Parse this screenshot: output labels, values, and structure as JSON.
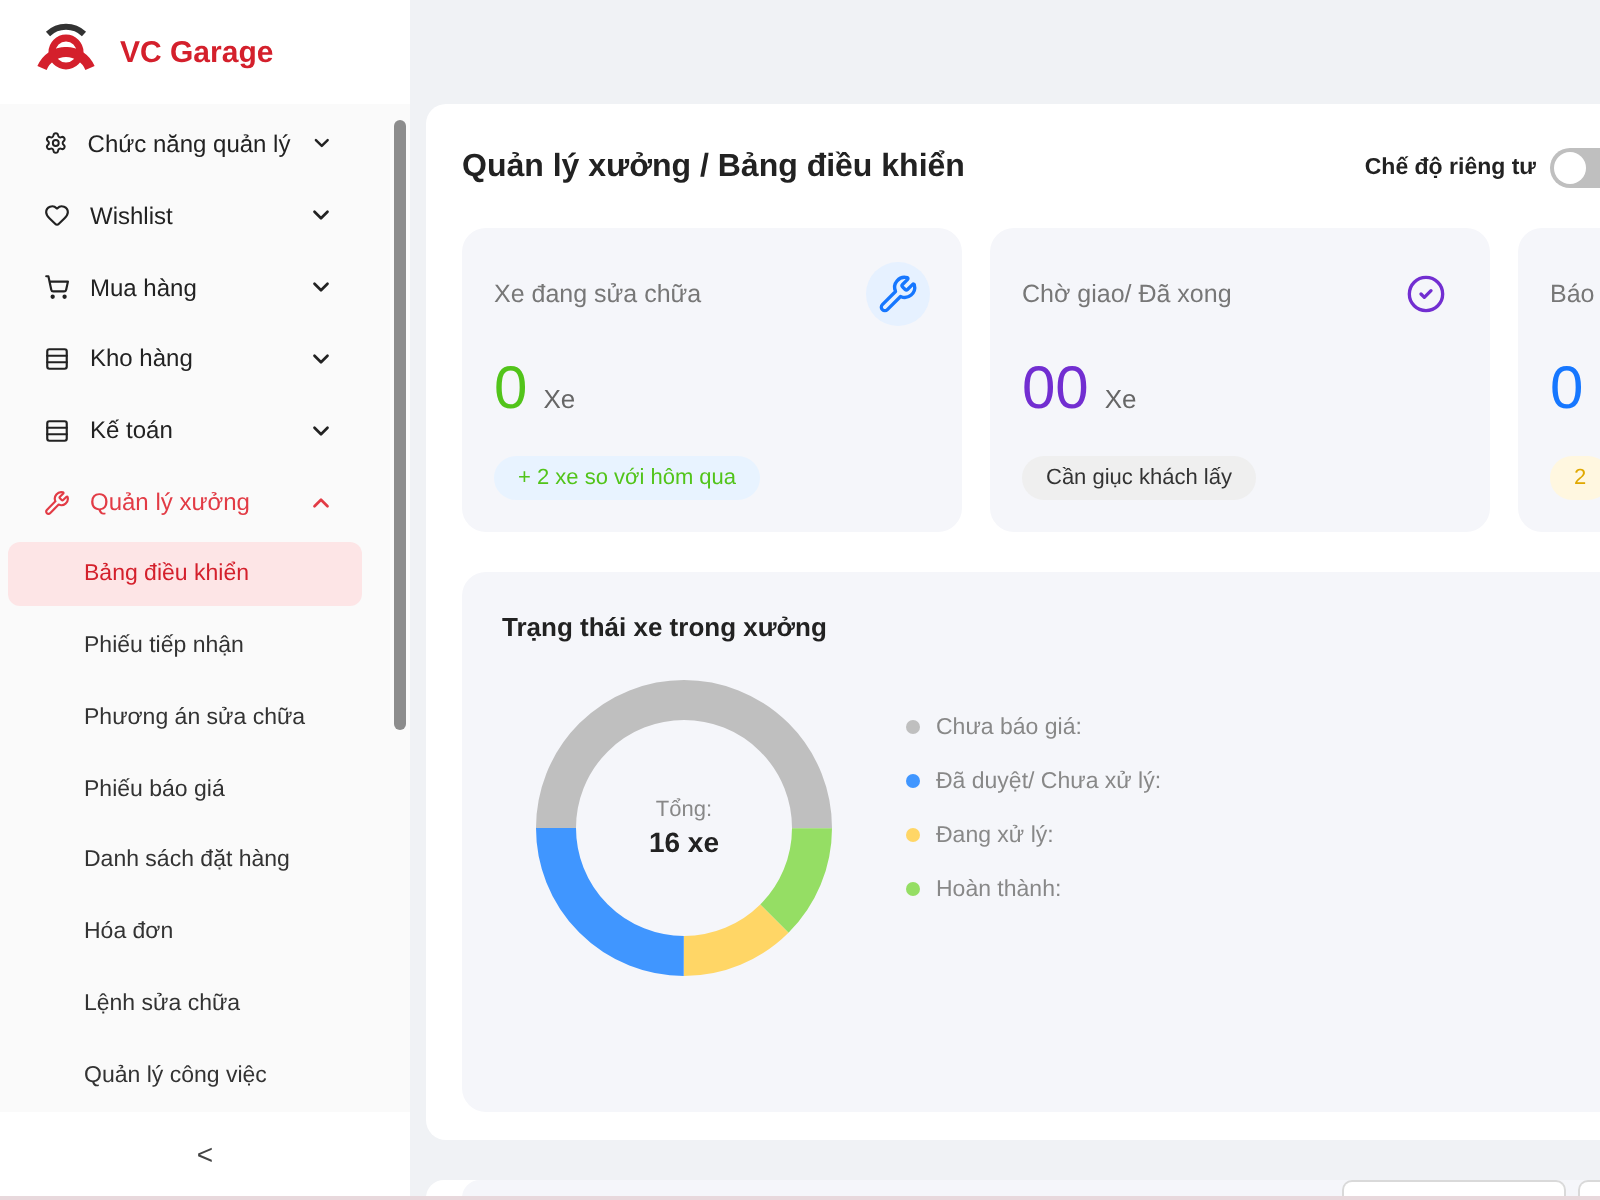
{
  "brand": {
    "name": "VC Garage"
  },
  "sidebar": {
    "items": [
      {
        "label": "Chức năng quản lý",
        "selected": false,
        "expanded": false
      },
      {
        "label": "Wishlist",
        "selected": false,
        "expanded": false
      },
      {
        "label": "Mua hàng",
        "selected": false,
        "expanded": false
      },
      {
        "label": "Kho hàng",
        "selected": false,
        "expanded": false
      },
      {
        "label": "Kế toán",
        "selected": false,
        "expanded": false
      },
      {
        "label": "Quản lý xưởng",
        "selected": true,
        "expanded": true,
        "children": [
          {
            "label": "Bảng điều khiển",
            "selected": true
          },
          {
            "label": "Phiếu tiếp nhận",
            "selected": false
          },
          {
            "label": "Phương án sửa chữa",
            "selected": false
          },
          {
            "label": "Phiếu báo giá",
            "selected": false
          },
          {
            "label": "Danh sách đặt hàng",
            "selected": false
          },
          {
            "label": "Hóa đơn",
            "selected": false
          },
          {
            "label": "Lệnh sửa chữa",
            "selected": false
          },
          {
            "label": "Quản lý công việc",
            "selected": false
          }
        ]
      }
    ],
    "collapse": "<"
  },
  "header": {
    "title": "Quản lý xưởng / Bảng điều khiển",
    "privacy": {
      "label": "Chế độ riêng tư",
      "on": false
    }
  },
  "cards": [
    {
      "title": "Xe đang sửa chữa",
      "value": "0",
      "unit": "Xe",
      "color": "#52c41a",
      "badge": "+ 2 xe so với hôm qua",
      "kind": "up"
    },
    {
      "title": "Chờ giao/ Đã xong",
      "value": "00",
      "unit": "Xe",
      "color": "#722ed1",
      "badge": "Cần giục khách lấy",
      "kind": "neutral"
    },
    {
      "title": "Báo",
      "value": "0",
      "color": "#1677ff",
      "badge": "2",
      "kind": "warn"
    }
  ],
  "status_panel": {
    "title": "Trạng thái xe trong xưởng",
    "total_label": "Tổng:",
    "total": "16 xe",
    "legend": [
      {
        "label": "Chưa báo giá:",
        "color": "#bfbfbf"
      },
      {
        "label": "Đã duyệt/ Chưa xử lý:",
        "color": "#4096ff"
      },
      {
        "label": "Đang xử lý:",
        "color": "#ffd666"
      },
      {
        "label": "Hoàn thành:",
        "color": "#95de64"
      }
    ]
  }
}
